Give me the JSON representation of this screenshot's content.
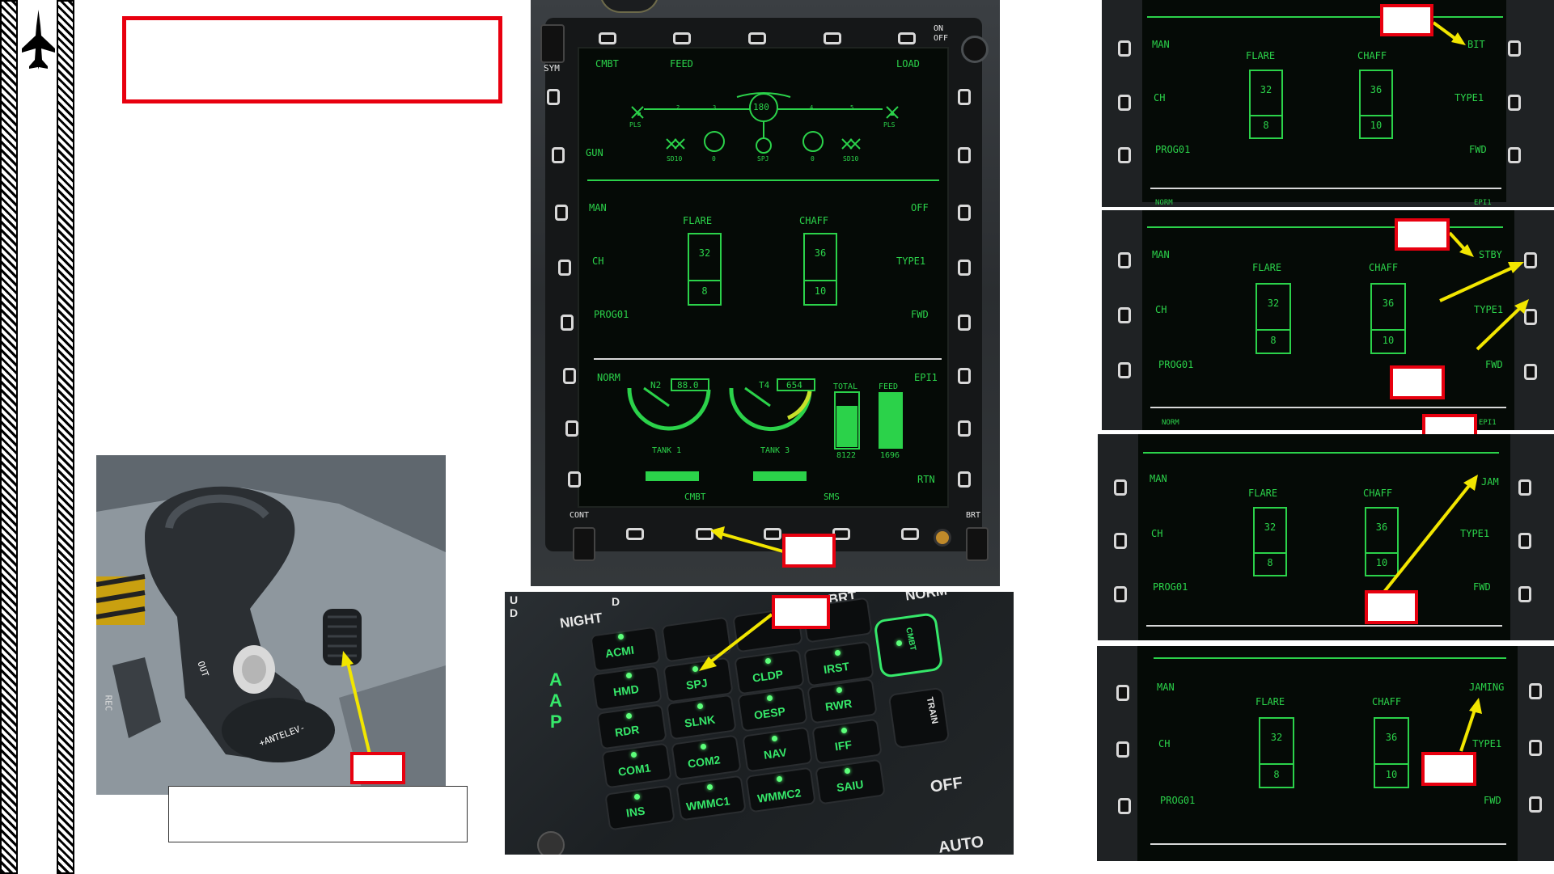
{
  "mfd_main": {
    "top_labels": {
      "cmbt": "CMBT",
      "feed": "FEED",
      "load": "LOAD"
    },
    "onoff": "ON\nOFF",
    "sym": "SYM",
    "stores": {
      "station_left_num": "180",
      "left_pls": "PLS",
      "right_pls": "PLS",
      "sd10_left": "SD10",
      "sd10_right": "SD10",
      "spj": "SPJ",
      "numbers": [
        "2",
        "3",
        "4",
        "5"
      ],
      "zero_left": "0",
      "zero_right": "0"
    },
    "gun": "GUN",
    "left_labels": {
      "man": "MAN",
      "ch": "CH",
      "prog": "PROG01",
      "norm": "NORM"
    },
    "right_labels": {
      "off": "OFF",
      "type1": "TYPE1",
      "fwd": "FWD",
      "epi1": "EPI1",
      "rtn": "RTN"
    },
    "flare": {
      "label": "FLARE",
      "top": "32",
      "bottom": "8"
    },
    "chaff": {
      "label": "CHAFF",
      "top": "36",
      "bottom": "10"
    },
    "engine": {
      "n2_label": "N2",
      "n2_value": "88.0",
      "t4_label": "T4",
      "t4_value": "654",
      "total_label": "TOTAL",
      "total_value": "8122",
      "feed_label": "FEED",
      "feed_value": "1696",
      "tank1": "TANK 1",
      "tank3": "TANK 3"
    },
    "bottom_labels": {
      "cmbt": "CMBT",
      "sms": "SMS"
    },
    "cont": "CONT",
    "brt": "BRT"
  },
  "aap_panel": {
    "title_letters": [
      "A",
      "A",
      "P"
    ],
    "night": "NIGHT",
    "corner_u": "U",
    "corner_d1": "D",
    "corner_d2": "D",
    "brt": "BRT",
    "norm": "NORM",
    "keys": [
      {
        "label": "ACMI"
      },
      {
        "label": "HMD"
      },
      {
        "label": "SPJ"
      },
      {
        "label": "CLDP"
      },
      {
        "label": "IRST"
      },
      {
        "label": "RDR"
      },
      {
        "label": "SLNK"
      },
      {
        "label": "OESP"
      },
      {
        "label": "RWR"
      },
      {
        "label": "COM1"
      },
      {
        "label": "COM2"
      },
      {
        "label": "NAV"
      },
      {
        "label": "IFF"
      },
      {
        "label": "INS"
      },
      {
        "label": "WMMC1"
      },
      {
        "label": "WMMC2"
      },
      {
        "label": "SAIU"
      }
    ],
    "cmbt": "CMBT",
    "train": "TRAIN",
    "off": "OFF",
    "auto": "AUTO"
  },
  "throttle_photo": {
    "labels": {
      "antelev": "+ANTELEV-",
      "out": "OUT",
      "rec": "REC"
    }
  },
  "mfd_crops": [
    {
      "man": "MAN",
      "ch": "CH",
      "prog": "PROG01",
      "flare": "FLARE",
      "chaff": "CHAFF",
      "f_top": "32",
      "f_bot": "8",
      "c_top": "36",
      "c_bot": "10",
      "r1": "BIT",
      "r2": "TYPE1",
      "r3": "FWD",
      "norm": "NORM",
      "epi": "EPI1"
    },
    {
      "man": "MAN",
      "ch": "CH",
      "prog": "PROG01",
      "flare": "FLARE",
      "chaff": "CHAFF",
      "f_top": "32",
      "f_bot": "8",
      "c_top": "36",
      "c_bot": "10",
      "r1": "STBY",
      "r2": "TYPE1",
      "r3": "FWD",
      "norm": "NORM",
      "epi": "EPI1"
    },
    {
      "man": "MAN",
      "ch": "CH",
      "prog": "PROG01",
      "flare": "FLARE",
      "chaff": "CHAFF",
      "f_top": "32",
      "f_bot": "8",
      "c_top": "36",
      "c_bot": "10",
      "r1": "JAM",
      "r2": "TYPE1",
      "r3": "FWD"
    },
    {
      "man": "MAN",
      "ch": "CH",
      "prog": "PROG01",
      "flare": "FLARE",
      "chaff": "CHAFF",
      "f_top": "32",
      "f_bot": "8",
      "c_top": "36",
      "c_bot": "10",
      "r1": "JAMING",
      "r2": "TYPE1",
      "r3": "FWD"
    }
  ],
  "colors": {
    "mfd_green": "#2bd24a",
    "callout_red": "#e8000f",
    "arrow_yellow": "#f2e600"
  },
  "icons": {
    "jet": "jet-silhouette-icon"
  }
}
